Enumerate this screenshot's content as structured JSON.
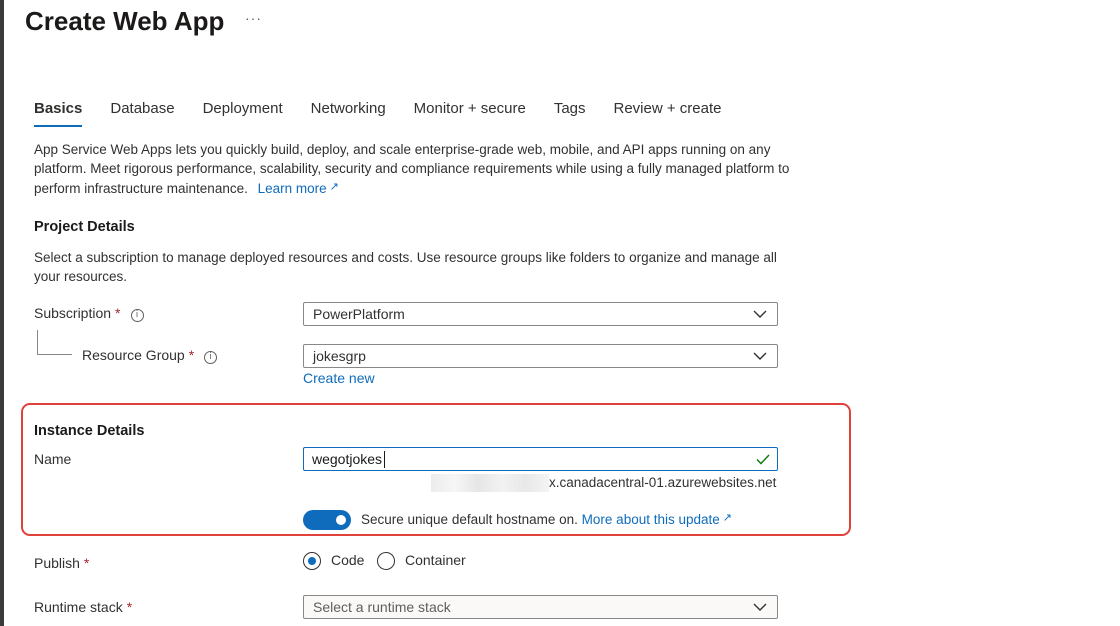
{
  "header": {
    "title": "Create Web App",
    "more": "···"
  },
  "tabs": [
    {
      "label": "Basics",
      "active": true
    },
    {
      "label": "Database"
    },
    {
      "label": "Deployment"
    },
    {
      "label": "Networking"
    },
    {
      "label": "Monitor + secure"
    },
    {
      "label": "Tags"
    },
    {
      "label": "Review + create"
    }
  ],
  "intro": {
    "text": "App Service Web Apps lets you quickly build, deploy, and scale enterprise-grade web, mobile, and API apps running on any platform. Meet rigorous performance, scalability, security and compliance requirements while using a fully managed platform to perform infrastructure maintenance.",
    "learn_more": "Learn more"
  },
  "project": {
    "heading": "Project Details",
    "description": "Select a subscription to manage deployed resources and costs. Use resource groups like folders to organize and manage all your resources.",
    "subscription_label": "Subscription",
    "subscription_value": "PowerPlatform",
    "resource_group_label": "Resource Group",
    "resource_group_value": "jokesgrp",
    "create_new": "Create new",
    "required_mark": "*",
    "info_glyph": "i"
  },
  "instance": {
    "heading": "Instance Details",
    "name_label": "Name",
    "name_value": "wegotjokes",
    "hostname_suffix": "x.canadacentral-01.azurewebsites.net",
    "toggle_on": true,
    "toggle_text": "Secure unique default hostname on.",
    "toggle_link": "More about this update"
  },
  "publish": {
    "label": "Publish",
    "options": [
      {
        "label": "Code",
        "selected": true
      },
      {
        "label": "Container",
        "selected": false
      }
    ]
  },
  "runtime": {
    "label": "Runtime stack",
    "placeholder": "Select a runtime stack"
  },
  "colors": {
    "accent": "#0f6cbd",
    "highlight_box": "#e0413b",
    "required": "#a4262c",
    "valid": "#107c10"
  },
  "icons": {
    "info": "info-icon",
    "chevron": "chevron-down-icon",
    "external": "external-link-icon",
    "check": "checkmark-icon"
  }
}
